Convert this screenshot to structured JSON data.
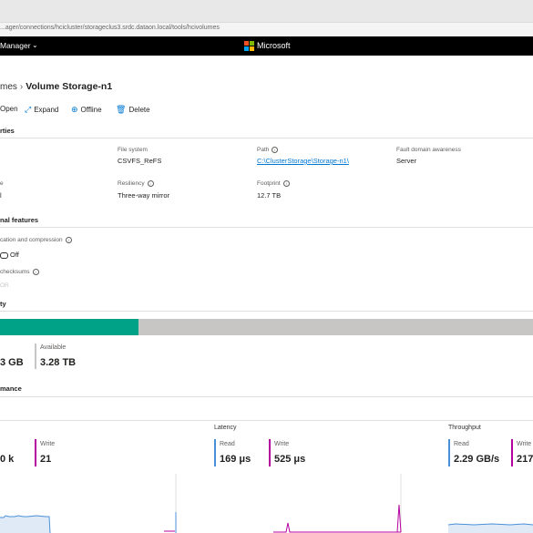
{
  "browser": {
    "url": "...ager/connections/hcicluster/storageclus3.srdc.dataon.local/tools/hcivolumes"
  },
  "app": {
    "title_fragment": "Manager",
    "brand": "Microsoft"
  },
  "breadcrumb": {
    "parent": "mes",
    "current": "Volume Storage-n1"
  },
  "toolbar": {
    "open": "Open",
    "expand": "Expand",
    "offline": "Offline",
    "delete": "Delete"
  },
  "properties": {
    "title": "rties",
    "file_system_label": "File system",
    "file_system_value": "CSVFS_ReFS",
    "path_label": "Path",
    "path_value": "C:\\ClusterStorage\\Storage-n1\\",
    "fault_domain_label": "Fault domain awareness",
    "fault_domain_value": "Server",
    "row2_left_label": "e",
    "row2_left_value": "l",
    "resiliency_label": "Resiliency",
    "resiliency_value": "Three-way mirror",
    "footprint_label": "Footprint",
    "footprint_value": "12.7 TB"
  },
  "optional_features": {
    "title": "nal features",
    "dedup_label": "cation and compression",
    "dedup_value": "Off",
    "checksums_label": "checksums",
    "checksums_value": "OR"
  },
  "capacity": {
    "title": "ty",
    "used_value": "3 GB",
    "available_label": "Available",
    "available_value": "3.28 TB",
    "used_fraction": 0.26
  },
  "performance": {
    "title": "mance",
    "iops": {
      "write_label": "Write",
      "read_value": "0 k",
      "write_value": "21"
    },
    "latency": {
      "title": "Latency",
      "read_label": "Read",
      "read_value": "169 μs",
      "write_label": "Write",
      "write_value": "525 μs"
    },
    "throughput": {
      "title": "Throughput",
      "read_label": "Read",
      "read_value": "2.29 GB/s",
      "write_label": "Write",
      "write_value": "217"
    }
  },
  "colors": {
    "read": "#4a90d9",
    "write": "#b4009e",
    "capacity_used": "#00a287",
    "accent": "#0078d4"
  }
}
